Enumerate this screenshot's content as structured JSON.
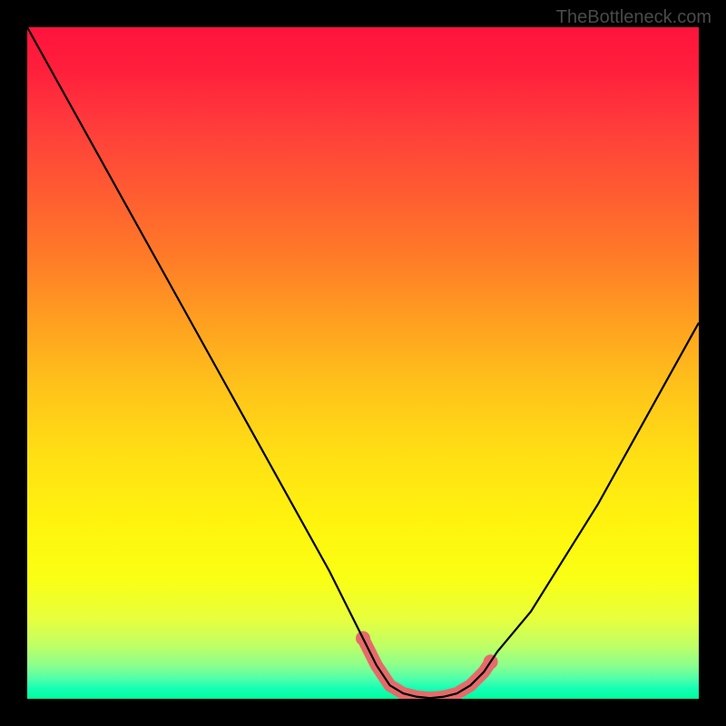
{
  "watermark": "TheBottleneck.com",
  "chart_data": {
    "type": "line",
    "title": "",
    "xlabel": "",
    "ylabel": "",
    "xlim": [
      0,
      100
    ],
    "ylim": [
      0,
      100
    ],
    "series": [
      {
        "name": "main-curve",
        "color": "#000000",
        "x": [
          0,
          5,
          10,
          15,
          20,
          25,
          30,
          35,
          40,
          45,
          50,
          52,
          54,
          56,
          58,
          60,
          62,
          64,
          66,
          68,
          70,
          75,
          80,
          85,
          90,
          95,
          100
        ],
        "values": [
          100,
          91,
          82,
          73,
          64,
          55,
          46,
          37,
          28,
          19,
          9,
          5,
          2,
          0.8,
          0.3,
          0.1,
          0.3,
          0.8,
          2,
          4,
          7,
          13,
          21,
          29,
          38,
          47,
          56
        ]
      },
      {
        "name": "highlight-band",
        "color": "#e66a6a",
        "x": [
          50,
          52,
          54,
          56,
          58,
          60,
          62,
          64,
          66,
          68,
          69
        ],
        "values": [
          9,
          5,
          2,
          0.8,
          0.3,
          0.1,
          0.3,
          0.8,
          2,
          4,
          5.5
        ]
      }
    ],
    "gradient_bands": [
      {
        "pct": 0,
        "color": "#ff143c"
      },
      {
        "pct": 14,
        "color": "#ff3a3c"
      },
      {
        "pct": 34,
        "color": "#ff7a28"
      },
      {
        "pct": 54,
        "color": "#ffc41a"
      },
      {
        "pct": 74,
        "color": "#fff40e"
      },
      {
        "pct": 92,
        "color": "#c0ff64"
      },
      {
        "pct": 100,
        "color": "#00ff9c"
      }
    ]
  }
}
